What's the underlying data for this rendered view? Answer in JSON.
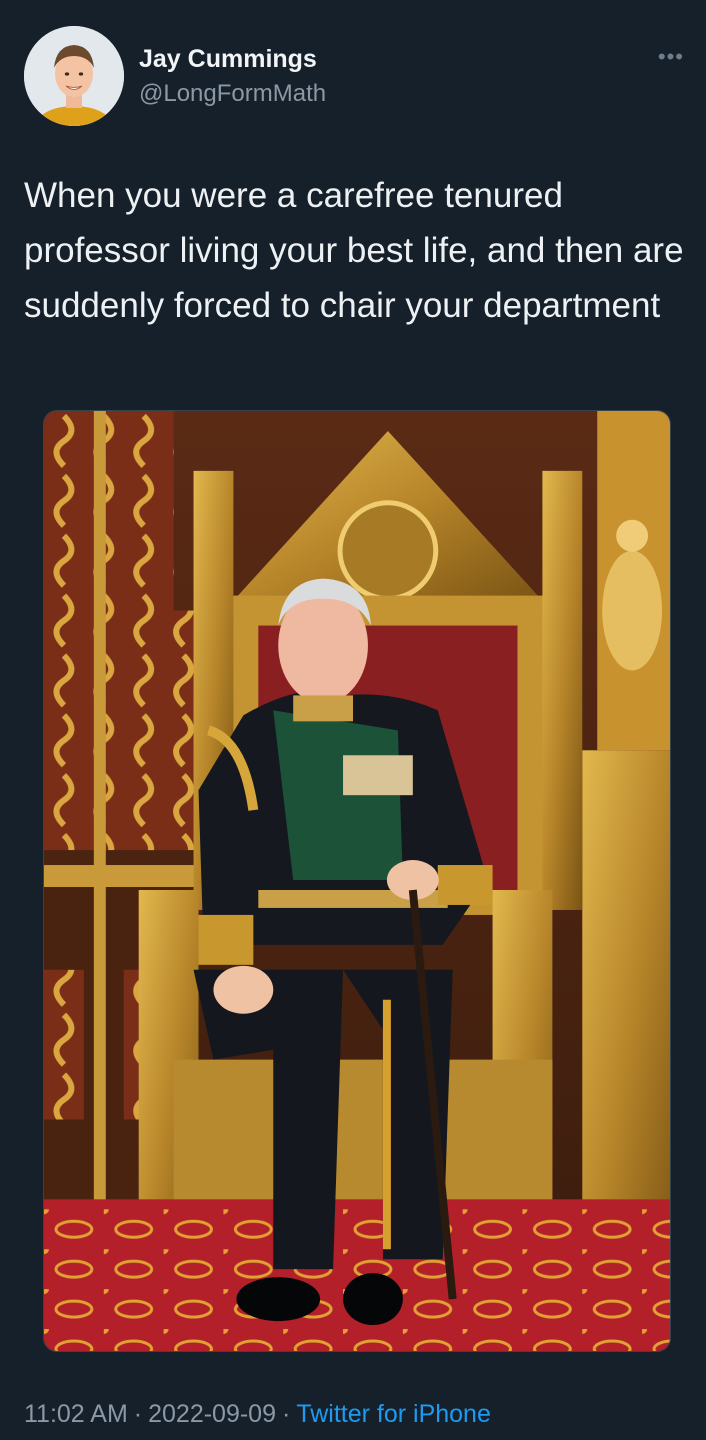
{
  "user": {
    "display_name": "Jay Cummings",
    "handle": "@LongFormMath",
    "avatar_icon": "user-avatar-photo"
  },
  "more_icon": "more-dots-icon",
  "tweet": {
    "text": "When you were a carefree tenured professor living your best life, and then are suddenly forced to chair your department"
  },
  "media": {
    "kind": "photo"
  },
  "meta": {
    "time": "11:02 AM",
    "separator": "·",
    "date": "2022-09-09",
    "source": "Twitter for iPhone"
  },
  "colors": {
    "background": "#15202b",
    "secondary_text": "#8b98a5",
    "link": "#1d9bf0"
  }
}
